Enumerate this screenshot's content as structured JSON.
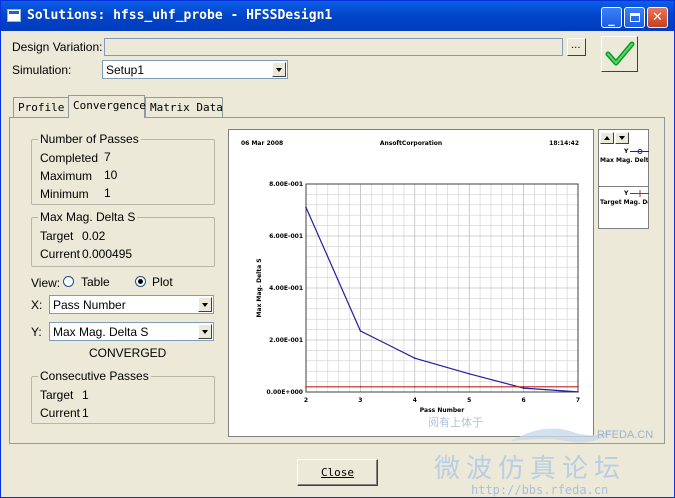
{
  "window": {
    "title": "Solutions: hfss_uhf_probe - HFSSDesign1"
  },
  "form": {
    "design_variation_label": "Design Variation:",
    "design_variation_value": "",
    "ellipsis_label": "...",
    "simulation_label": "Simulation:",
    "simulation_value": "Setup1"
  },
  "tabs": [
    {
      "label": "Profile"
    },
    {
      "label": "Convergence",
      "active": true
    },
    {
      "label": "Matrix Data"
    }
  ],
  "passes": {
    "title": "Number of Passes",
    "completed_label": "Completed",
    "completed": "7",
    "maximum_label": "Maximum",
    "maximum": "10",
    "minimum_label": "Minimum",
    "minimum": "1"
  },
  "delta": {
    "title": "Max Mag. Delta S",
    "target_label": "Target",
    "target": "0.02",
    "current_label": "Current",
    "current": "0.000495"
  },
  "view": {
    "label": "View:",
    "table_label": "Table",
    "plot_label": "Plot",
    "selected": "Plot"
  },
  "axes_select": {
    "x_label": "X:",
    "x_value": "Pass Number",
    "y_label": "Y:",
    "y_value": "Max Mag. Delta S"
  },
  "status": "CONVERGED",
  "consecutive": {
    "title": "Consecutive Passes",
    "target_label": "Target",
    "target": "1",
    "current_label": "Current",
    "current": "1"
  },
  "chart_header": {
    "date": "06 Mar 2008",
    "company": "AnsoftCorporation",
    "time": "18:14:42"
  },
  "legend": {
    "entries": [
      {
        "prefix": "Y",
        "name": "Max Mag. Delta S",
        "color": "#2020a0"
      },
      {
        "prefix": "Y",
        "name": "Target Mag. Delta S",
        "color": "#c02020"
      }
    ]
  },
  "chart_data": {
    "type": "line",
    "xlabel": "Pass Number",
    "ylabel": "Max Mag. Delta S",
    "xlim": [
      2,
      7
    ],
    "ylim": [
      0,
      0.8
    ],
    "x_ticks": [
      "2",
      "3",
      "4",
      "5",
      "6",
      "7"
    ],
    "y_ticks": [
      "0.00E+000",
      "2.00E-001",
      "4.00E-001",
      "6.00E-001",
      "8.00E-001"
    ],
    "x": [
      2,
      3,
      4,
      5,
      6,
      7
    ],
    "series": [
      {
        "name": "Max Mag. Delta S",
        "color": "#2020a0",
        "values": [
          0.71,
          0.235,
          0.13,
          0.07,
          0.015,
          0.000495
        ]
      },
      {
        "name": "Target Mag. Delta S",
        "color": "#c02020",
        "values": [
          0.02,
          0.02,
          0.02,
          0.02,
          0.02,
          0.02
        ]
      }
    ],
    "grid": true
  },
  "buttons": {
    "close": "Close"
  },
  "watermark": {
    "site": "RFEDA.CN",
    "chinese": "微波仿真论坛",
    "url": "http://bbs.rfeda.cn",
    "small": "阅有上体于"
  }
}
